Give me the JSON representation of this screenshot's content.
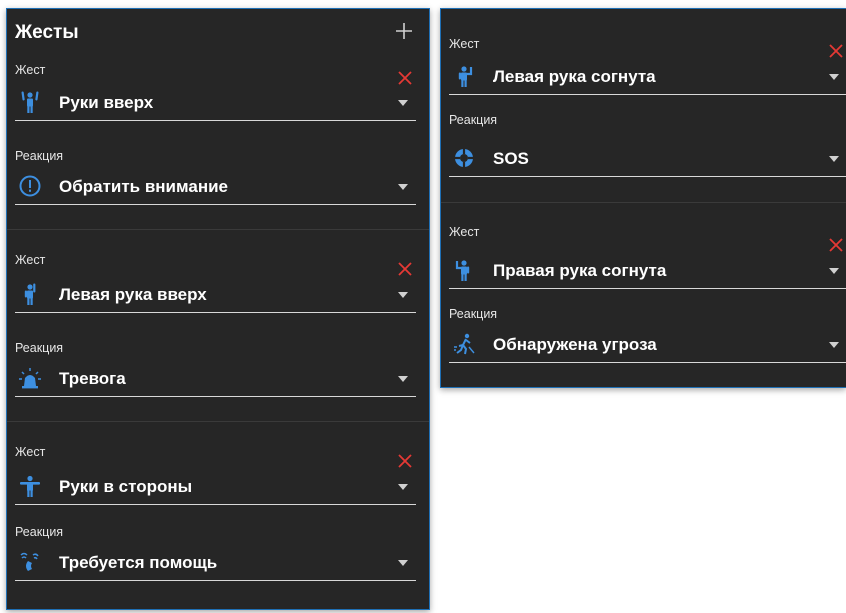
{
  "accent_color": "#3d8fe0",
  "close_color": "#e53935",
  "left_panel": {
    "title": "Жесты",
    "add_icon": "plus-icon",
    "cards": [
      {
        "gesture_label": "Жест",
        "gesture_value": "Руки вверх",
        "gesture_icon": "hands-up-icon",
        "reaction_label": "Реакция",
        "reaction_value": "Обратить внимание",
        "reaction_icon": "exclamation-circle-icon"
      },
      {
        "gesture_label": "Жест",
        "gesture_value": "Левая рука вверх",
        "gesture_icon": "left-hand-up-icon",
        "reaction_label": "Реакция",
        "reaction_value": "Тревога",
        "reaction_icon": "alarm-light-icon"
      },
      {
        "gesture_label": "Жест",
        "gesture_value": "Руки в стороны",
        "gesture_icon": "arms-out-icon",
        "reaction_label": "Реакция",
        "reaction_value": "Требуется помощь",
        "reaction_icon": "help-signal-icon"
      }
    ]
  },
  "right_panel": {
    "cards": [
      {
        "gesture_label": "Жест",
        "gesture_value": "Левая рука согнута",
        "gesture_icon": "left-arm-bent-icon",
        "reaction_label": "Реакция",
        "reaction_value": "SOS",
        "reaction_icon": "lifebuoy-icon"
      },
      {
        "gesture_label": "Жест",
        "gesture_value": "Правая рука согнута",
        "gesture_icon": "right-arm-bent-icon",
        "reaction_label": "Реакция",
        "reaction_value": "Обнаружена угроза",
        "reaction_icon": "threat-detected-icon"
      }
    ]
  }
}
